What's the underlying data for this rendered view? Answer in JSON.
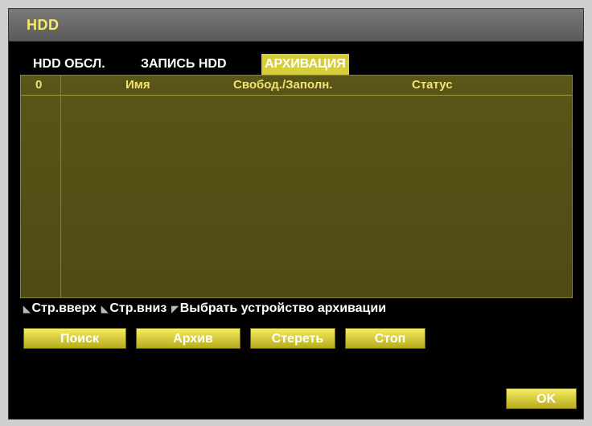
{
  "window": {
    "title": "HDD"
  },
  "tabs": [
    {
      "label": "HDD ОБСЛ."
    },
    {
      "label": "ЗАПИСЬ HDD"
    },
    {
      "label": "АРХИВАЦИЯ",
      "active": true
    }
  ],
  "table": {
    "columns": [
      "0",
      "Имя",
      "Свобод./Заполн.",
      "Статус"
    ],
    "rows": []
  },
  "hints": [
    {
      "icon": "page-up-icon",
      "label": "Стр.вверх"
    },
    {
      "icon": "page-down-icon",
      "label": "Стр.вниз"
    },
    {
      "icon": "device-select-icon",
      "label": "Выбрать устройство архивации"
    }
  ],
  "buttons": {
    "search": "Поиск",
    "archive": "Архив",
    "erase": "Стереть",
    "stop": "Стоп",
    "ok": "OK"
  },
  "colors": {
    "accent": "#d6cd3a",
    "header_text": "#f0e270",
    "table_bg": "#555016"
  }
}
